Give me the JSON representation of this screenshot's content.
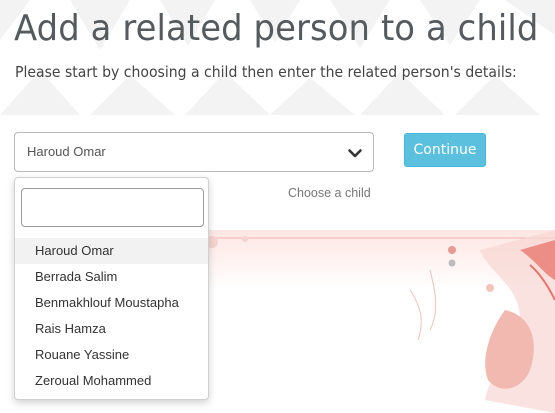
{
  "header": {
    "title": "Add a related person to a child",
    "subtitle": "Please start by choosing a child then enter the related person's details:"
  },
  "form": {
    "child_select": {
      "selected": "Haroud Omar",
      "helper": "Choose a child",
      "search_placeholder": "",
      "options": [
        "Haroud Omar",
        "Berrada Salim",
        "Benmakhlouf Moustapha",
        "Rais Hamza",
        "Rouane Yassine",
        "Zeroual Mohammed"
      ],
      "highlighted_index": 0
    },
    "continue_label": "Continue"
  },
  "colors": {
    "accent": "#5bc0de",
    "title": "#555a5e",
    "deco_pink": "#f4c7c3",
    "deco_red": "#e8736a"
  },
  "icons": {
    "select_toggle": "chevron-down-icon"
  }
}
